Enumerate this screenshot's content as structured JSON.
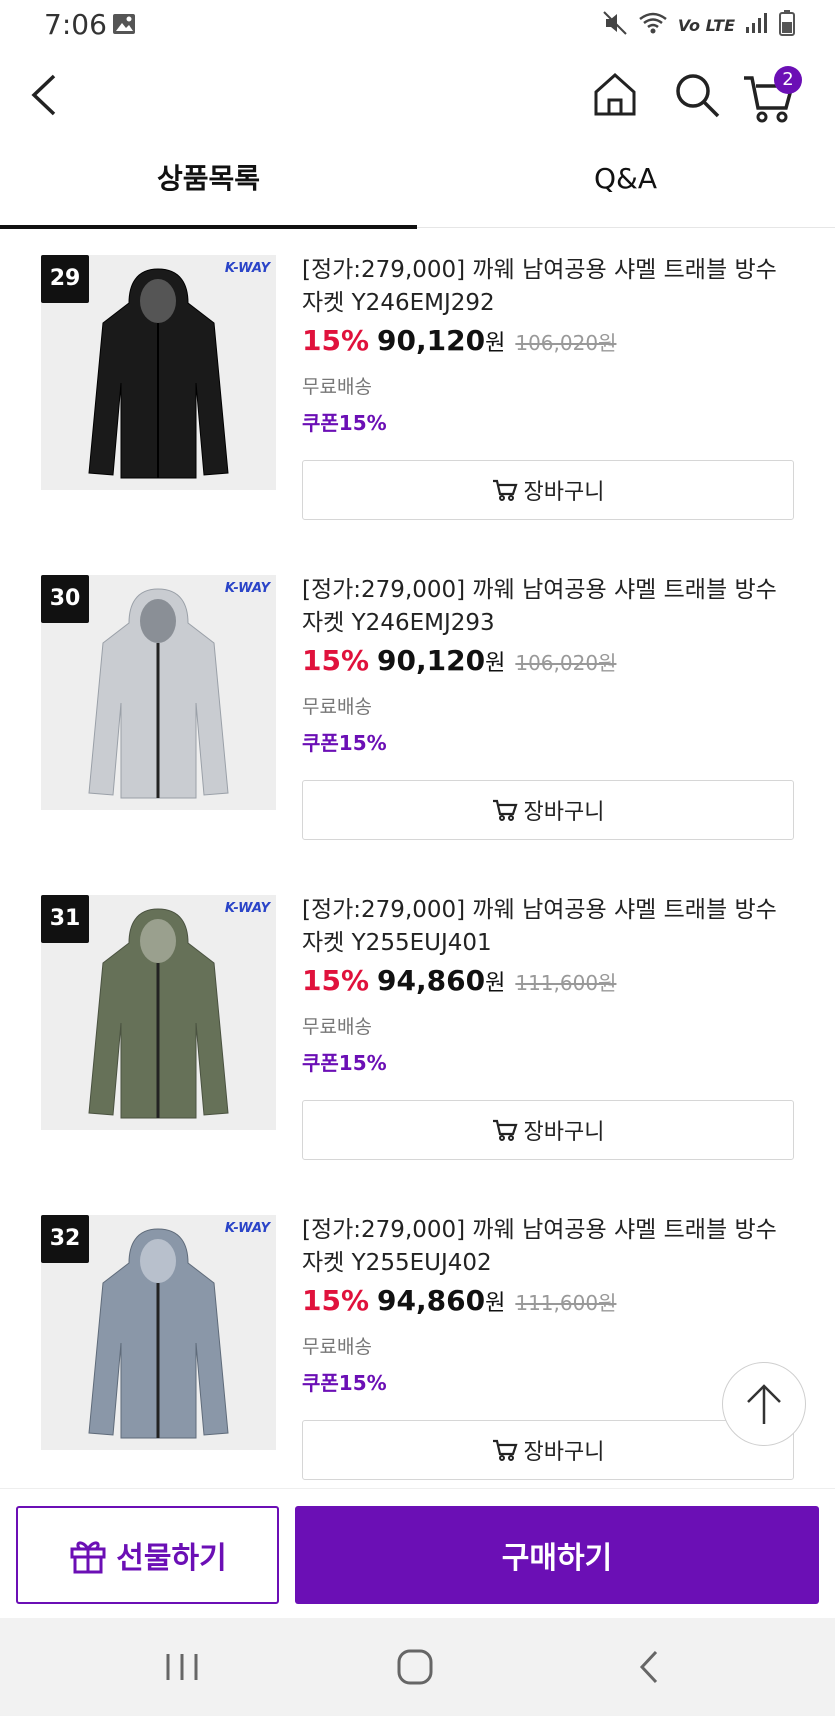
{
  "status_bar": {
    "time": "7:06",
    "network": "Vo LTE"
  },
  "header": {
    "cart_count": "2"
  },
  "tabs": [
    {
      "label": "상품목록",
      "active": true
    },
    {
      "label": "Q&A",
      "active": false
    }
  ],
  "brand_logo": "K-WAY",
  "items": [
    {
      "rank": "29",
      "title": "[정가:279,000] 까웨 남여공용 샤멜 트래블 방수 자켓 Y246EMJ292",
      "discount": "15%",
      "price": "90,120",
      "currency": "원",
      "original_price": "106,020원",
      "shipping": "무료배송",
      "coupon": "쿠폰15%",
      "cart_label": "장바구니",
      "color": "#1a1a1a"
    },
    {
      "rank": "30",
      "title": "[정가:279,000] 까웨 남여공용 샤멜 트래블 방수 자켓 Y246EMJ293",
      "discount": "15%",
      "price": "90,120",
      "currency": "원",
      "original_price": "106,020원",
      "shipping": "무료배송",
      "coupon": "쿠폰15%",
      "cart_label": "장바구니",
      "color": "#c9ccd1"
    },
    {
      "rank": "31",
      "title": "[정가:279,000] 까웨 남여공용 샤멜 트래블 방수 자켓 Y255EUJ401",
      "discount": "15%",
      "price": "94,860",
      "currency": "원",
      "original_price": "111,600원",
      "shipping": "무료배송",
      "coupon": "쿠폰15%",
      "cart_label": "장바구니",
      "color": "#667158"
    },
    {
      "rank": "32",
      "title": "[정가:279,000] 까웨 남여공용 샤멜 트래블 방수 자켓 Y255EUJ402",
      "discount": "15%",
      "price": "94,860",
      "currency": "원",
      "original_price": "111,600원",
      "shipping": "무료배송",
      "coupon": "쿠폰15%",
      "cart_label": "장바구니",
      "color": "#8a97a8"
    }
  ],
  "bottom": {
    "gift_label": "선물하기",
    "buy_label": "구매하기"
  },
  "colors": {
    "accent": "#6b0fb5",
    "discount": "#e0123c"
  }
}
